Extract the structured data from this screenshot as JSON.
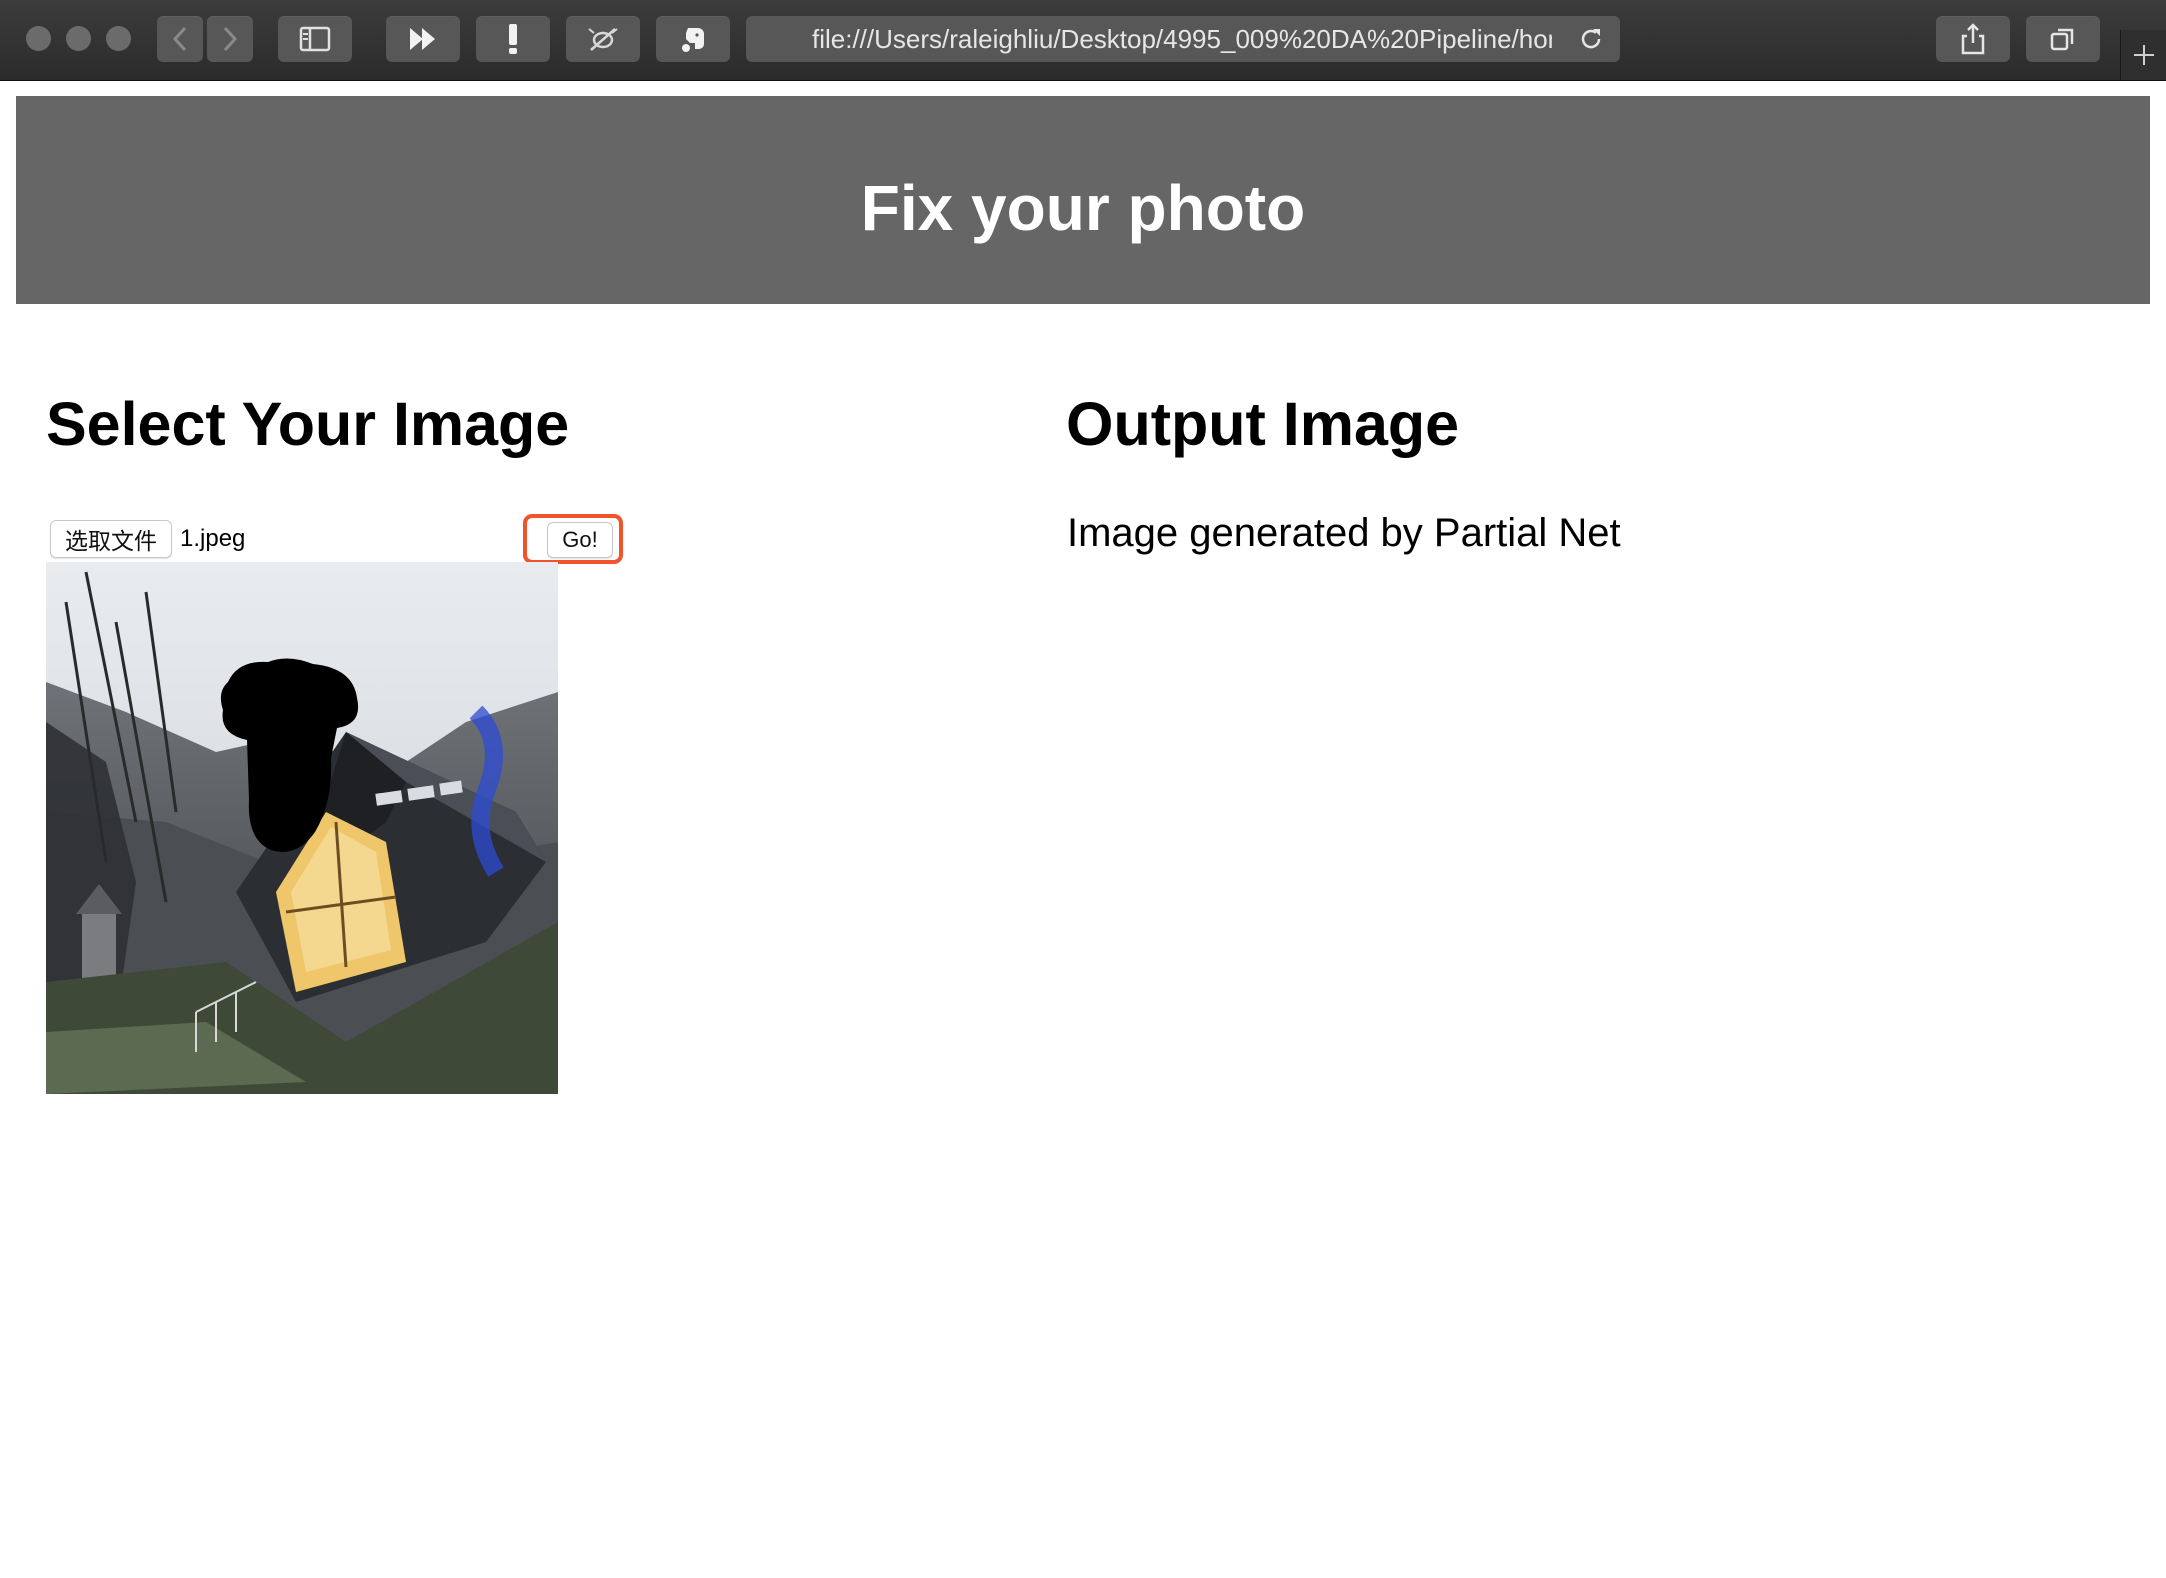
{
  "browser": {
    "url": "file:///Users/raleighliu/Desktop/4995_009%20DA%20Pipeline/hom",
    "new_tab_glyph": "+"
  },
  "header": {
    "title": "Fix your photo"
  },
  "left_panel": {
    "title": "Select Your Image",
    "choose_file_label": "选取文件",
    "file_name": "1.jpeg",
    "go_label": "Go!"
  },
  "right_panel": {
    "title": "Output Image",
    "caption": "Image generated by Partial Net"
  },
  "colors": {
    "header_bg": "#666666",
    "highlight": "#f0542d",
    "toolbar_bg": "#2b2b2b"
  }
}
